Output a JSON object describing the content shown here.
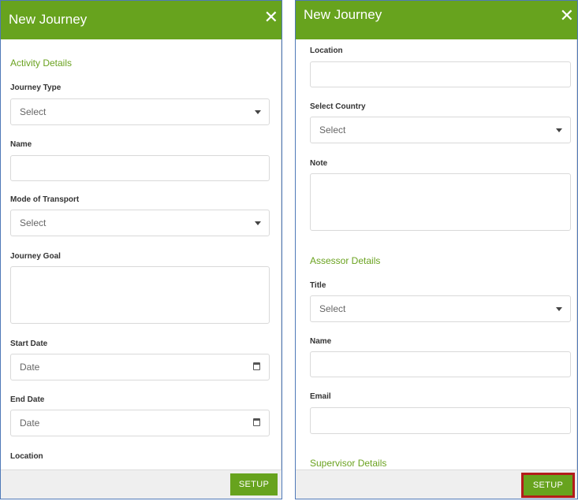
{
  "left_panel": {
    "header_title": "New Journey",
    "close_symbol": "✕",
    "section_activity": "Activity Details",
    "journey_type_label": "Journey Type",
    "journey_type_value": "Select",
    "name_label": "Name",
    "mode_label": "Mode of Transport",
    "mode_value": "Select",
    "goal_label": "Journey Goal",
    "start_label": "Start Date",
    "start_placeholder": "Date",
    "end_label": "End Date",
    "end_placeholder": "Date",
    "location_label": "Location",
    "setup_label": "SETUP"
  },
  "right_panel": {
    "header_title": "New Journey",
    "close_symbol": "✕",
    "location_label": "Location",
    "country_label": "Select Country",
    "country_value": "Select",
    "note_label": "Note",
    "section_assessor": "Assessor Details",
    "title_label": "Title",
    "title_value": "Select",
    "name_label": "Name",
    "email_label": "Email",
    "section_supervisor": "Supervisor Details",
    "setup_label": "SETUP"
  },
  "colors": {
    "accent_green": "#67a31e",
    "highlight_red": "#b31b1b",
    "panel_border": "#4f79b8"
  },
  "icons": [
    "close-icon",
    "chevron-down-icon",
    "calendar-icon"
  ]
}
